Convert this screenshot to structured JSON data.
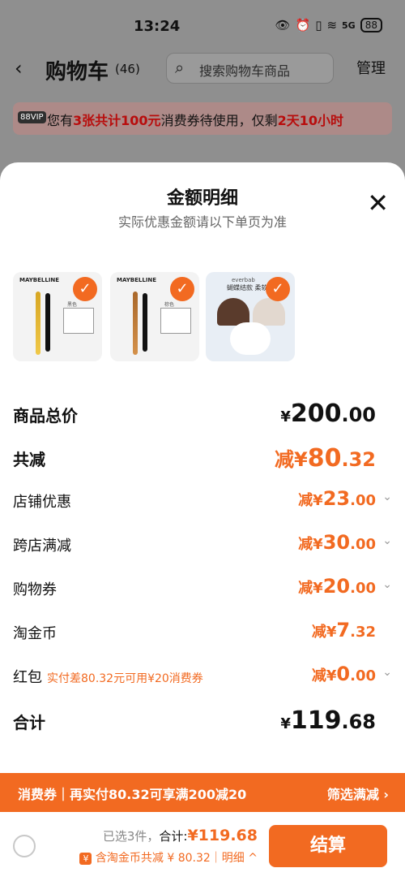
{
  "status": {
    "time": "13:24",
    "icons": [
      "eye-icon",
      "alarm-icon",
      "vibrate-icon",
      "wifi-icon",
      "5g-icon"
    ],
    "battery": "88"
  },
  "cart": {
    "title": "购物车",
    "count": "(46)",
    "search_placeholder": "搜索购物车商品",
    "manage": "管理"
  },
  "coupon_banner": {
    "vip": "88VIP",
    "prefix": "您有",
    "highlight1": "3张共计100元",
    "middle": "消费券待使用，仅剩",
    "highlight2": "2天10小时"
  },
  "sheet": {
    "title": "金额明细",
    "subtitle": "实际优惠金额请以下单页为准",
    "products": [
      {
        "brand": "MAYBELLINE",
        "swatch": "黑色"
      },
      {
        "brand": "MAYBELLINE",
        "swatch": "棕色"
      },
      {
        "brand": "everbab",
        "text": "蝴蝶结款 柔软心"
      }
    ],
    "rows": [
      {
        "label": "商品总价",
        "sym": "¥",
        "main": "200",
        "dec": ".00",
        "black": true
      },
      {
        "label": "共减",
        "sym": "减¥",
        "main": "80",
        "dec": ".32"
      },
      {
        "label": "店铺优惠",
        "sym": "减¥",
        "main": "23",
        "dec": ".00"
      },
      {
        "label": "跨店满减",
        "sym": "减¥",
        "main": "30",
        "dec": ".00"
      },
      {
        "label": "购物券",
        "sym": "减¥",
        "main": "20",
        "dec": ".00"
      },
      {
        "label": "淘金币",
        "sym": "减¥",
        "main": "7",
        "dec": ".32"
      },
      {
        "label": "红包",
        "note": "实付差80.32元可用¥20消费券",
        "sym": "减¥",
        "main": "0",
        "dec": ".00"
      },
      {
        "label": "合计",
        "sym": "¥",
        "main": "119",
        "dec": ".68",
        "black": true
      }
    ]
  },
  "promo": {
    "left": "消费券｜再实付80.32可享满200减20",
    "right": "筛选满减 ›"
  },
  "bottom": {
    "selected": "已选3件，",
    "total_label": "合计:",
    "total_amount": "¥119.68",
    "coin_text": "含淘金币共减 ¥ 80.32｜明细 ^",
    "coin_icon": "¥",
    "pay": "结算"
  },
  "colors": {
    "accent": "#f26a21",
    "banner_red": "#b80d0d"
  }
}
